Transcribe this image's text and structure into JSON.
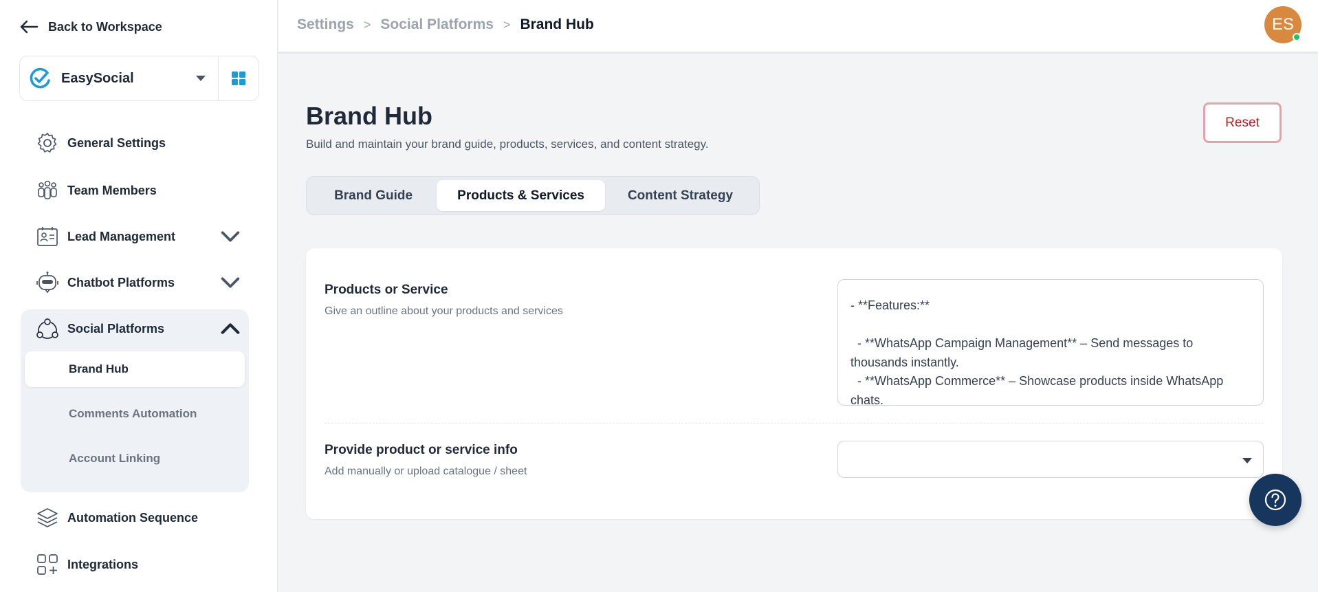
{
  "sidebar": {
    "back_label": "Back to Workspace",
    "workspace_name": "EasySocial",
    "nav": {
      "general": "General Settings",
      "team": "Team Members",
      "lead": "Lead Management",
      "chatbot": "Chatbot Platforms",
      "social": "Social Platforms",
      "automation": "Automation Sequence",
      "integrations": "Integrations"
    },
    "social_sub": {
      "brand_hub": "Brand Hub",
      "comments": "Comments Automation",
      "account": "Account Linking"
    }
  },
  "header": {
    "breadcrumbs": [
      "Settings",
      "Social Platforms",
      "Brand Hub"
    ],
    "separator": ">",
    "avatar_initials": "ES"
  },
  "main": {
    "title": "Brand Hub",
    "subtitle": "Build and maintain your brand guide, products, services, and content strategy.",
    "reset_label": "Reset",
    "tabs": [
      "Brand Guide",
      "Products & Services",
      "Content Strategy"
    ],
    "active_tab": "Products & Services",
    "products_field": {
      "label": "Products or Service",
      "help": "Give an outline about your products and services",
      "value": "- **Features:**\n\n  - **WhatsApp Campaign Management** – Send messages to thousands instantly.\n  - **WhatsApp Commerce** – Showcase products inside WhatsApp chats."
    },
    "info_field": {
      "label": "Provide product or service info",
      "help": "Add manually or upload catalogue / sheet",
      "value": ""
    }
  },
  "colors": {
    "accent_blue": "#1e9bd7",
    "avatar": "#d9893e",
    "reset_red": "#b91c1c",
    "help_fab": "#17365d"
  },
  "icons": [
    "arrow-left-icon",
    "easysocial-logo-icon",
    "grid-icon",
    "gear-icon",
    "team-icon",
    "contact-card-icon",
    "chatbot-icon",
    "social-network-icon",
    "layers-icon",
    "integrations-icon",
    "chevron-down-icon",
    "chevron-up-icon",
    "question-icon"
  ]
}
